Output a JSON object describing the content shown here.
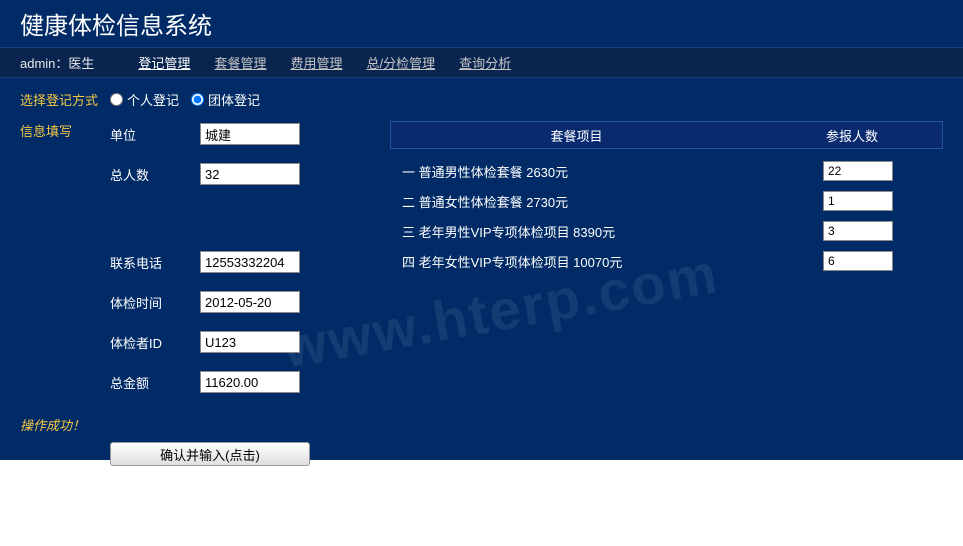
{
  "header": {
    "title": "健康体检信息系统"
  },
  "nav": {
    "user_label": "admin：医生",
    "items": [
      {
        "label": "登记管理",
        "active": true
      },
      {
        "label": "套餐管理",
        "active": false
      },
      {
        "label": "费用管理",
        "active": false
      },
      {
        "label": "总/分检管理",
        "active": false
      },
      {
        "label": "查询分析",
        "active": false
      }
    ]
  },
  "form": {
    "select_mode_label": "选择登记方式",
    "mode_personal": "个人登记",
    "mode_group": "团体登记",
    "info_section_label": "信息填写",
    "unit_label": "单位",
    "unit_value": "城建",
    "total_people_label": "总人数",
    "total_people_value": "32",
    "phone_label": "联系电话",
    "phone_value": "12553332204",
    "exam_time_label": "体检时间",
    "exam_time_value": "2012-05-20",
    "examinee_id_label": "体检者ID",
    "examinee_id_value": "U123",
    "total_amount_label": "总金额",
    "total_amount_value": "11620.00",
    "success_msg": "操作成功！",
    "submit_label": "确认并输入(点击)"
  },
  "table": {
    "header_package": "套餐项目",
    "header_count": "参报人数",
    "rows": [
      {
        "label": "一 普通男性体检套餐 2630元",
        "count": "22"
      },
      {
        "label": "二 普通女性体检套餐 2730元",
        "count": "1"
      },
      {
        "label": "三 老年男性VIP专项体检项目 8390元",
        "count": "3"
      },
      {
        "label": "四 老年女性VIP专项体检项目 10070元",
        "count": "6"
      }
    ]
  },
  "watermark": "www.hterp.com"
}
